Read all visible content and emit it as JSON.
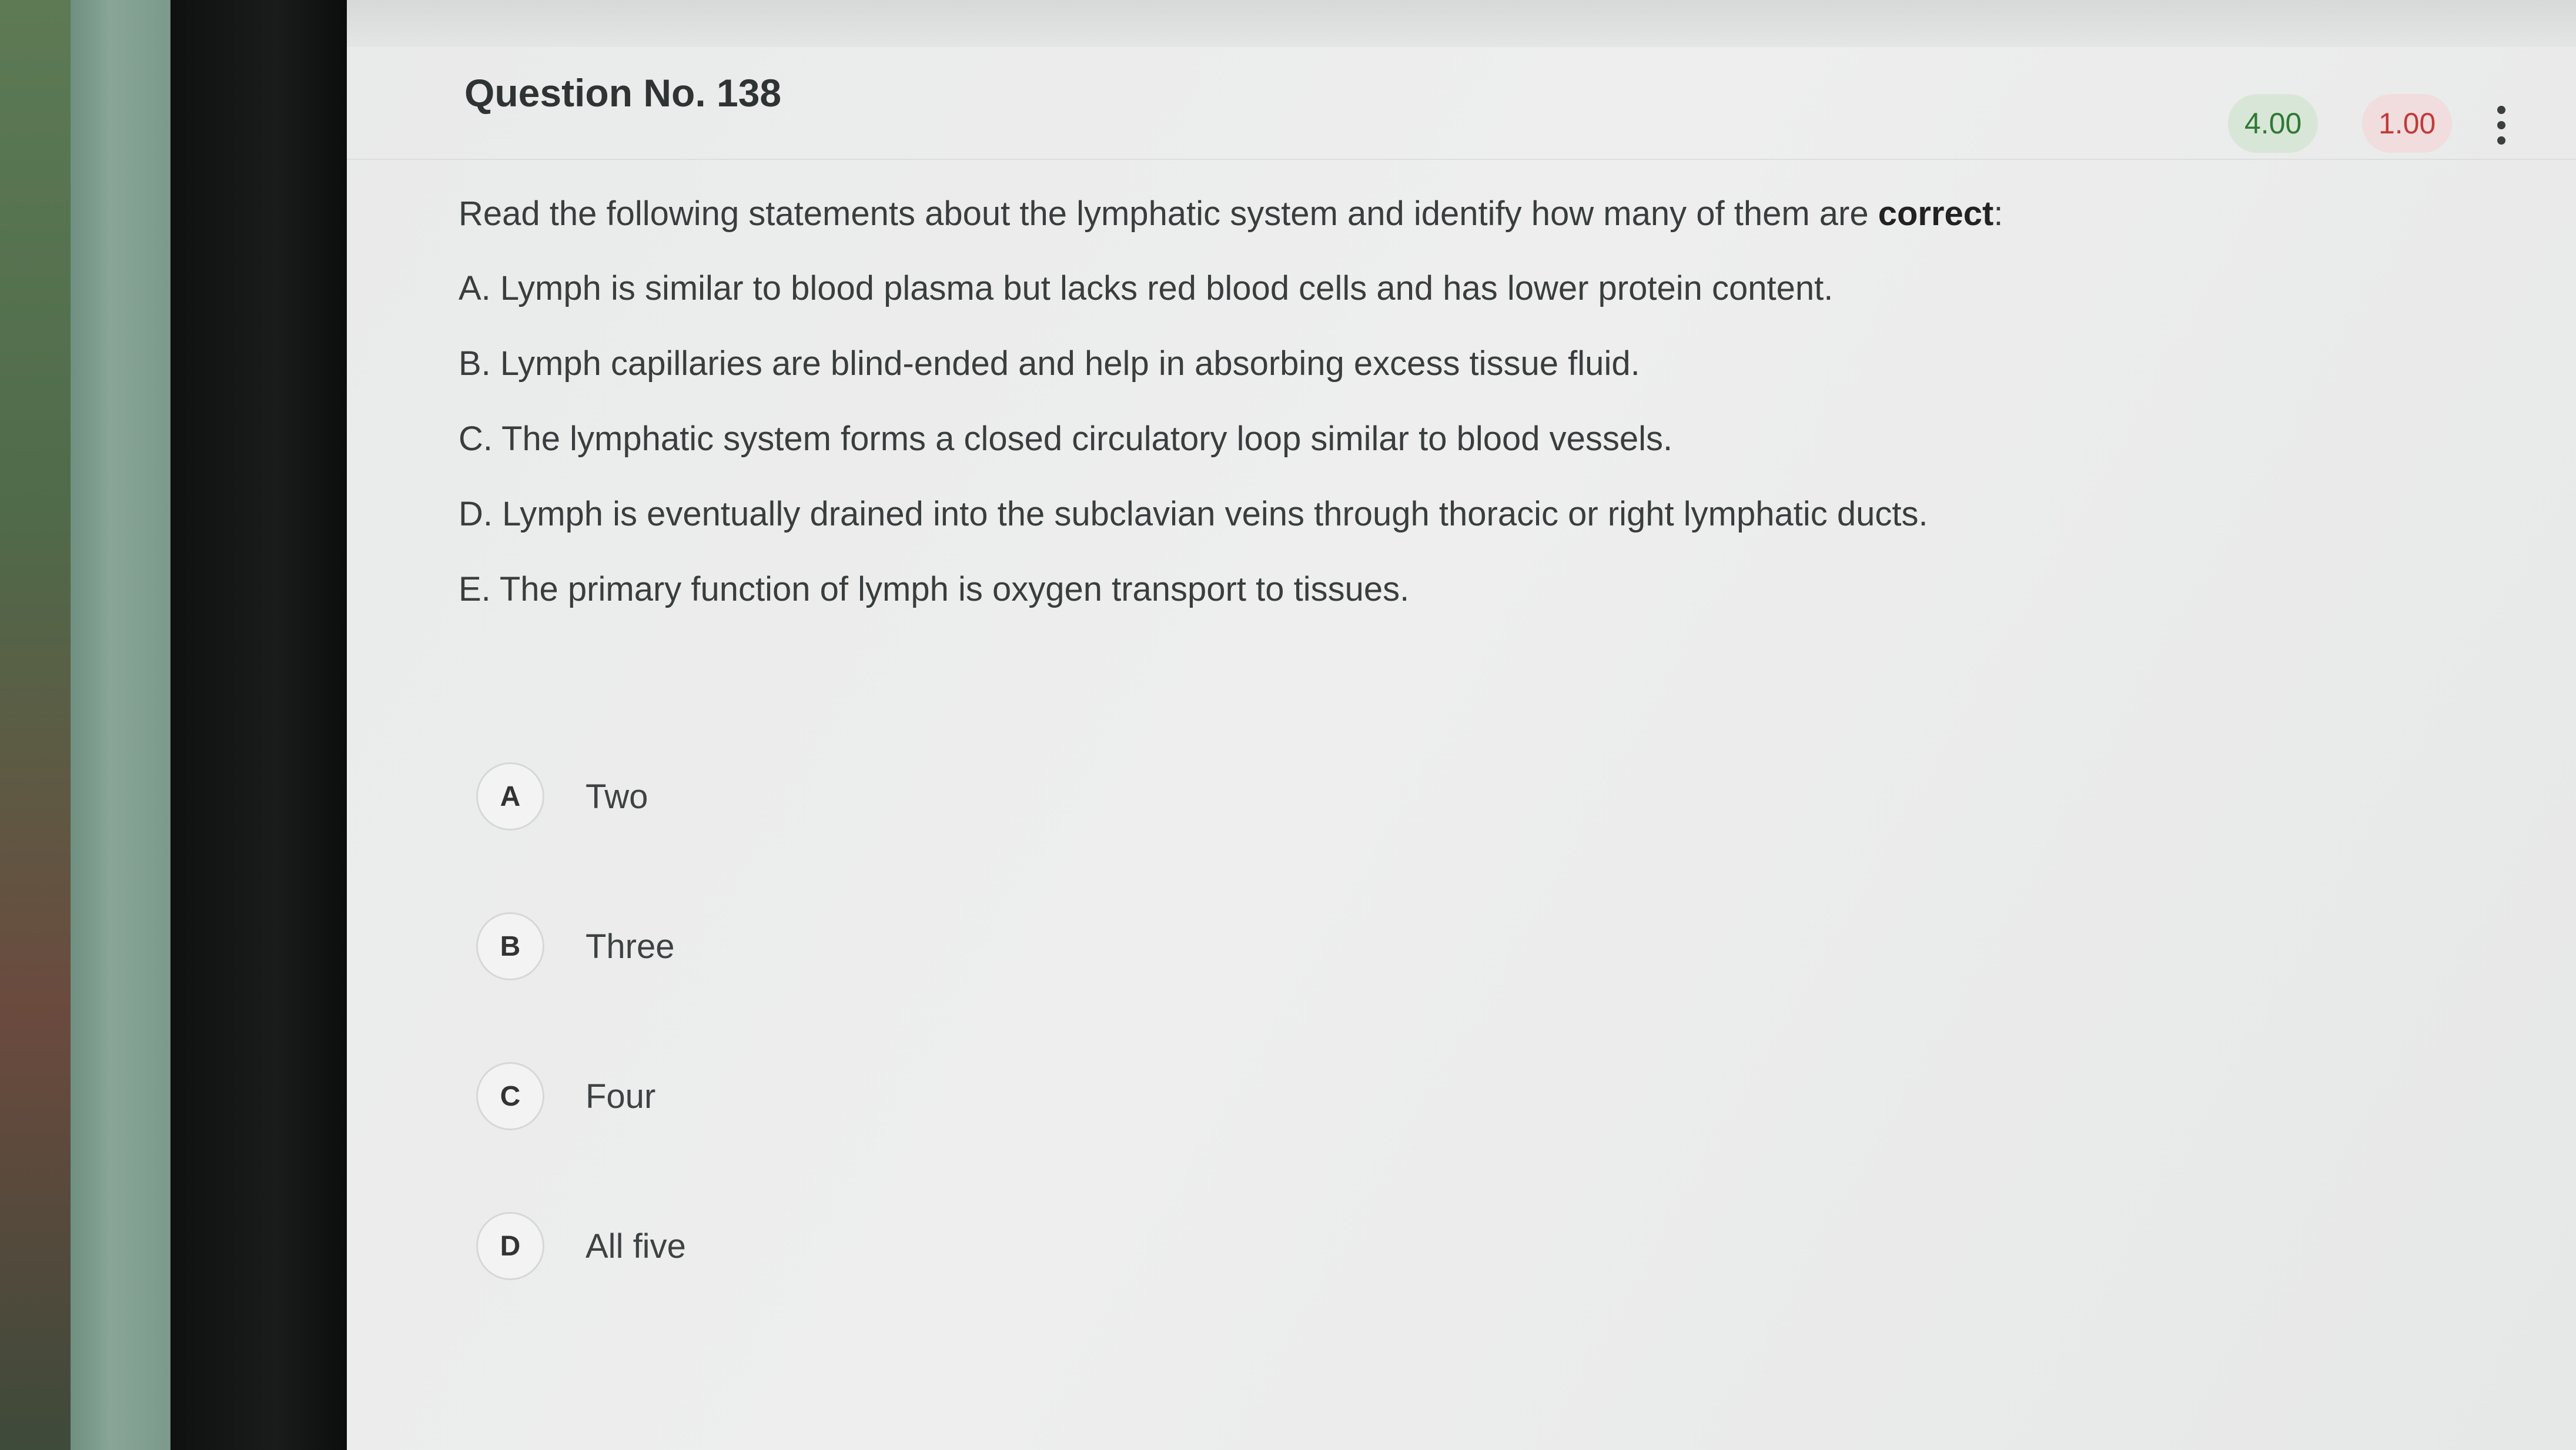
{
  "header": {
    "question_title": "Question No. 138",
    "positive_marks": "4.00",
    "negative_marks": "1.00"
  },
  "question": {
    "stem_prefix": "Read the following statements about the lymphatic system and identify how many of them are ",
    "stem_emphasis": "correct",
    "stem_suffix": ":",
    "statements": [
      "A. Lymph is similar to blood plasma but lacks red blood cells and has lower protein content.",
      "B. Lymph capillaries are blind-ended and help in absorbing excess tissue fluid.",
      "C. The lymphatic system forms a closed circulatory loop similar to blood vessels.",
      "D. Lymph is eventually drained into the subclavian veins through thoracic or right lymphatic ducts.",
      "E. The primary function of lymph is oxygen transport to tissues."
    ]
  },
  "options": [
    {
      "letter": "A",
      "label": "Two"
    },
    {
      "letter": "B",
      "label": "Three"
    },
    {
      "letter": "C",
      "label": "Four"
    },
    {
      "letter": "D",
      "label": "All five"
    }
  ],
  "icons": {
    "menu": "kebab-menu-icon"
  },
  "colors": {
    "positive": "#2e7a32",
    "negative": "#c23a3a"
  }
}
